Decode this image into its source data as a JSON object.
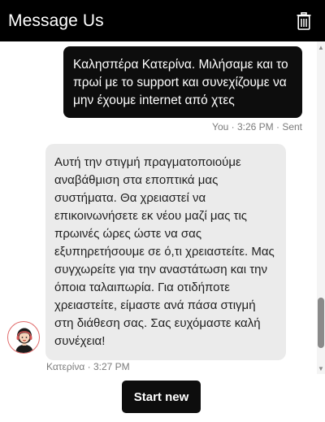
{
  "header": {
    "title": "Message Us",
    "delete_icon": "trash-icon"
  },
  "messages": [
    {
      "sender": "user",
      "text": "Καλησπέρα Κατερίνα. Μιλήσαμε και το πρωί με το support και συνεχίζουμε να μην έχουμε internet από χτες",
      "meta": "You · 3:26 PM · Sent"
    },
    {
      "sender": "agent",
      "text": "Αυτή την στιγμή πραγματοποιούμε αναβάθμιση στα εποπτικά μας συστήματα. Θα χρειαστεί να επικοινωνήσετε εκ νέου μαζί μας τις πρωινές ώρες ώστε να σας εξυπηρετήσουμε σε ό,τι χρειαστείτε. Μας συγχωρείτε για την αναστάτωση και την όποια ταλαιπωρία. Για οτιδήποτε χρειαστείτε, είμαστε ανά πάσα στιγμή στη διάθεση σας. Σας ευχόμαστε καλή συνέχεια!",
      "meta": "Κατερίνα · 3:27 PM",
      "avatar_icon": "agent-avatar-icon"
    }
  ],
  "footer": {
    "start_new_label": "Start new"
  },
  "colors": {
    "header_bg": "#000000",
    "user_bubble_bg": "#0d0d0d",
    "agent_bubble_bg": "#ebebeb",
    "button_bg": "#0d0d0d"
  }
}
